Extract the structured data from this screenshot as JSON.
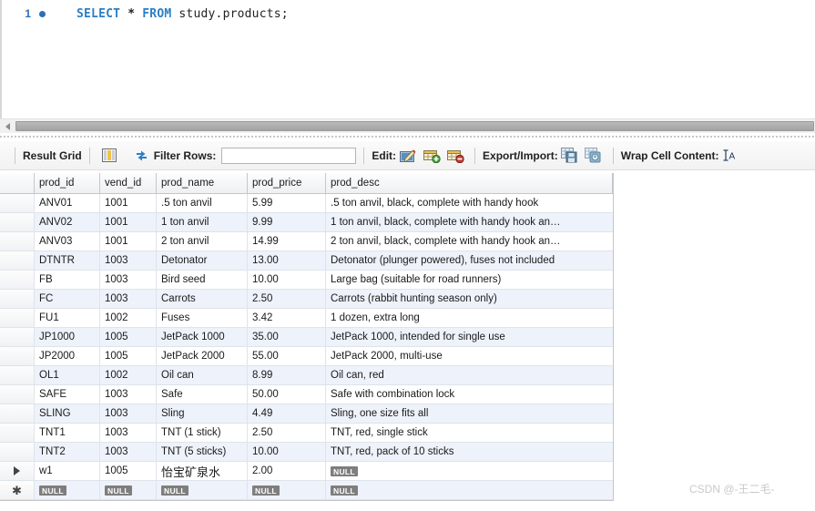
{
  "editor": {
    "line_number": "1",
    "breakpoint_marker": "bullet",
    "sql_tokens": {
      "select": "SELECT",
      "star": "*",
      "from": "FROM",
      "table": "study.products;"
    },
    "full_query": "SELECT * FROM study.products;"
  },
  "scrollbar": {
    "left_arrow": "left-arrow",
    "orientation": "horizontal"
  },
  "toolbar": {
    "result_grid_label": "Result Grid",
    "grid_view_icon": "grid-view-icon",
    "refresh_icon": "refresh-icon",
    "filter_rows_label": "Filter Rows:",
    "filter_rows_value": "",
    "filter_rows_placeholder": "",
    "edit_label": "Edit:",
    "edit_pencil_icon": "edit-pencil-icon",
    "add_row_icon": "add-row-icon",
    "delete_row_icon": "delete-row-icon",
    "export_import_label": "Export/Import:",
    "export_icon": "export-recordset-icon",
    "import_icon": "import-recordset-icon",
    "wrap_cell_label": "Wrap Cell Content:",
    "wrap_cell_icon": "wrap-cell-content-icon"
  },
  "grid": {
    "columns": [
      {
        "key": "prod_id",
        "label": "prod_id"
      },
      {
        "key": "vend_id",
        "label": "vend_id"
      },
      {
        "key": "prod_name",
        "label": "prod_name"
      },
      {
        "key": "prod_price",
        "label": "prod_price"
      },
      {
        "key": "prod_desc",
        "label": "prod_desc"
      }
    ],
    "rows": [
      {
        "marker": "",
        "prod_id": "ANV01",
        "vend_id": "1001",
        "prod_name": ".5 ton anvil",
        "prod_price": "5.99",
        "prod_desc": ".5 ton anvil, black, complete with handy hook"
      },
      {
        "marker": "",
        "prod_id": "ANV02",
        "vend_id": "1001",
        "prod_name": "1 ton anvil",
        "prod_price": "9.99",
        "prod_desc": "1 ton anvil, black, complete with handy hook an…"
      },
      {
        "marker": "",
        "prod_id": "ANV03",
        "vend_id": "1001",
        "prod_name": "2 ton anvil",
        "prod_price": "14.99",
        "prod_desc": "2 ton anvil, black, complete with handy hook an…"
      },
      {
        "marker": "",
        "prod_id": "DTNTR",
        "vend_id": "1003",
        "prod_name": "Detonator",
        "prod_price": "13.00",
        "prod_desc": "Detonator (plunger powered), fuses not included"
      },
      {
        "marker": "",
        "prod_id": "FB",
        "vend_id": "1003",
        "prod_name": "Bird seed",
        "prod_price": "10.00",
        "prod_desc": "Large bag (suitable for road runners)"
      },
      {
        "marker": "",
        "prod_id": "FC",
        "vend_id": "1003",
        "prod_name": "Carrots",
        "prod_price": "2.50",
        "prod_desc": "Carrots (rabbit hunting season only)"
      },
      {
        "marker": "",
        "prod_id": "FU1",
        "vend_id": "1002",
        "prod_name": "Fuses",
        "prod_price": "3.42",
        "prod_desc": "1 dozen, extra long"
      },
      {
        "marker": "",
        "prod_id": "JP1000",
        "vend_id": "1005",
        "prod_name": "JetPack 1000",
        "prod_price": "35.00",
        "prod_desc": "JetPack 1000, intended for single use"
      },
      {
        "marker": "",
        "prod_id": "JP2000",
        "vend_id": "1005",
        "prod_name": "JetPack 2000",
        "prod_price": "55.00",
        "prod_desc": "JetPack 2000, multi-use"
      },
      {
        "marker": "",
        "prod_id": "OL1",
        "vend_id": "1002",
        "prod_name": "Oil can",
        "prod_price": "8.99",
        "prod_desc": "Oil can, red"
      },
      {
        "marker": "",
        "prod_id": "SAFE",
        "vend_id": "1003",
        "prod_name": "Safe",
        "prod_price": "50.00",
        "prod_desc": "Safe with combination lock"
      },
      {
        "marker": "",
        "prod_id": "SLING",
        "vend_id": "1003",
        "prod_name": "Sling",
        "prod_price": "4.49",
        "prod_desc": "Sling, one size fits all"
      },
      {
        "marker": "",
        "prod_id": "TNT1",
        "vend_id": "1003",
        "prod_name": "TNT (1 stick)",
        "prod_price": "2.50",
        "prod_desc": "TNT, red, single stick"
      },
      {
        "marker": "",
        "prod_id": "TNT2",
        "vend_id": "1003",
        "prod_name": "TNT (5 sticks)",
        "prod_price": "10.00",
        "prod_desc": "TNT, red, pack of 10 sticks"
      },
      {
        "marker": "current",
        "prod_id": "w1",
        "vend_id": "1005",
        "prod_name": "怡宝矿泉水",
        "prod_price": "2.00",
        "prod_desc": "NULL"
      },
      {
        "marker": "new",
        "prod_id": "NULL",
        "vend_id": "NULL",
        "prod_name": "NULL",
        "prod_price": "NULL",
        "prod_desc": "NULL"
      }
    ]
  },
  "watermark": {
    "text": "CSDN @-王二毛-"
  },
  "colors": {
    "keyword_blue": "#2b7fc4",
    "alt_row_blue": "#eef2fb",
    "null_badge_gray": "#7e7e7e",
    "watermark_gray": "#c9c9c9"
  }
}
